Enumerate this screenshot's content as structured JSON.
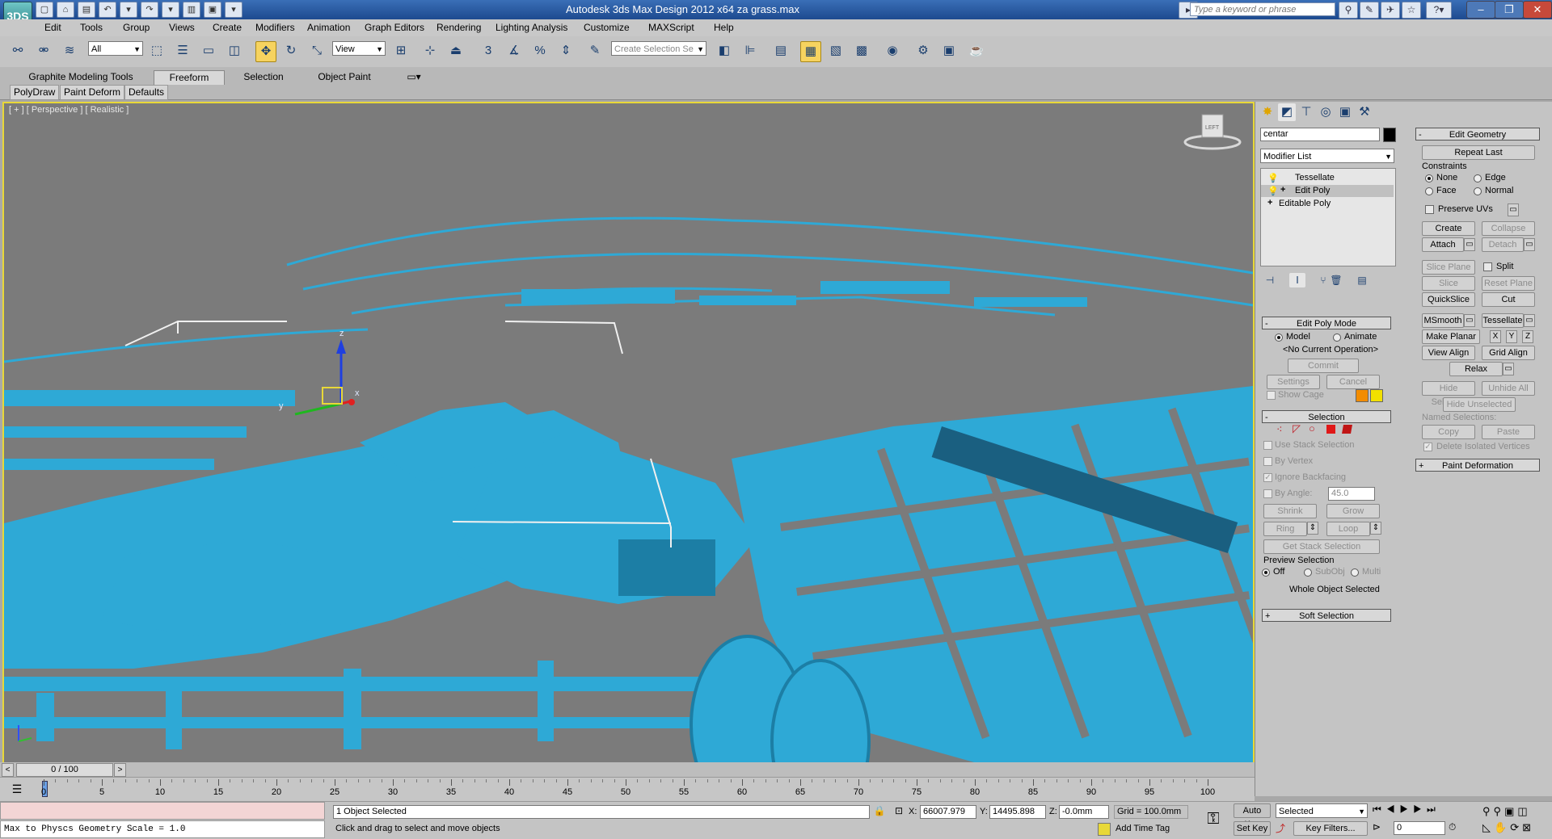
{
  "app": {
    "window_title": "Autodesk 3ds Max Design 2012 x64     za grass.max",
    "logo": "3DS",
    "search_placeholder": "Type a keyword or phrase"
  },
  "menu": [
    "Edit",
    "Tools",
    "Group",
    "Views",
    "Create",
    "Modifiers",
    "Animation",
    "Graph Editors",
    "Rendering",
    "Lighting Analysis",
    "Customize",
    "MAXScript",
    "Help"
  ],
  "toolbar": {
    "selection_filter": "All",
    "reference_coord": "View",
    "named_selection_placeholder": "Create Selection Se"
  },
  "ribbon": {
    "tabs": [
      "Graphite Modeling Tools",
      "Freeform",
      "Selection",
      "Object Paint"
    ],
    "active_tab": "Freeform",
    "subtabs": [
      "PolyDraw",
      "Paint Deform",
      "Defaults"
    ]
  },
  "viewport": {
    "label": "[ + ] [ Perspective ] [ Realistic ]",
    "viewcube_face": "LEFT",
    "gizmo_z": "z",
    "gizmo_x": "x",
    "gizmo_y": "y",
    "accent_color": "#e8d838",
    "model_color": "#2ea9d6"
  },
  "command_panel": {
    "object_name": "centar",
    "modifier_list": "Modifier List",
    "stack": [
      "Tessellate",
      "Edit Poly",
      "Editable Poly"
    ],
    "edit_poly_mode": {
      "title": "Edit Poly Mode",
      "model": "Model",
      "animate": "Animate",
      "current_op": "<No Current Operation>",
      "commit": "Commit",
      "settings": "Settings",
      "cancel": "Cancel",
      "show_cage": "Show Cage"
    },
    "selection": {
      "title": "Selection",
      "use_stack": "Use Stack Selection",
      "by_vertex": "By Vertex",
      "ignore_backfacing": "Ignore Backfacing",
      "by_angle": "By Angle:",
      "angle_value": "45.0",
      "shrink": "Shrink",
      "grow": "Grow",
      "ring": "Ring",
      "loop": "Loop",
      "get_stack": "Get Stack Selection",
      "preview_title": "Preview Selection",
      "off": "Off",
      "subobj": "SubObj",
      "multi": "Multi",
      "status": "Whole Object Selected"
    },
    "soft_selection": "Soft Selection",
    "edit_geometry": {
      "title": "Edit Geometry",
      "repeat_last": "Repeat Last",
      "constraints": "Constraints",
      "none": "None",
      "edge": "Edge",
      "face": "Face",
      "normal": "Normal",
      "preserve_uvs": "Preserve UVs",
      "create": "Create",
      "collapse": "Collapse",
      "attach": "Attach",
      "detach": "Detach",
      "slice_plane": "Slice Plane",
      "split": "Split",
      "slice": "Slice",
      "reset_plane": "Reset Plane",
      "quickslice": "QuickSlice",
      "cut": "Cut",
      "msmooth": "MSmooth",
      "tessellate": "Tessellate",
      "make_planar": "Make Planar",
      "x": "X",
      "y": "Y",
      "z": "Z",
      "view_align": "View Align",
      "grid_align": "Grid Align",
      "relax": "Relax",
      "hide_selected": "Hide Selected",
      "unhide_all": "Unhide All",
      "hide_unselected": "Hide Unselected",
      "named_selections": "Named Selections:",
      "copy": "Copy",
      "paste": "Paste",
      "delete_isolated": "Delete Isolated Vertices"
    },
    "paint_deformation": "Paint Deformation"
  },
  "timeline": {
    "frame": "0 / 100",
    "ticks": [
      "0",
      "5",
      "10",
      "15",
      "20",
      "25",
      "30",
      "35",
      "40",
      "45",
      "50",
      "55",
      "60",
      "65",
      "70",
      "75",
      "80",
      "85",
      "90",
      "95",
      "100"
    ]
  },
  "status": {
    "script_listener": "Max to Physcs Geometry Scale = 1.0",
    "selected_count": "1 Object Selected",
    "prompt": "Click and drag to select and move objects",
    "x_label": "X:",
    "x_value": "66007.979",
    "y_label": "Y:",
    "y_value": "14495.898",
    "z_label": "Z:",
    "z_value": "-0.0mm",
    "grid": "Grid = 100.0mm",
    "add_time_tag": "Add Time Tag",
    "auto_key": "Auto Key",
    "set_key": "Set Key",
    "key_mode": "Selected",
    "key_filters": "Key Filters...",
    "current_frame": "0"
  }
}
